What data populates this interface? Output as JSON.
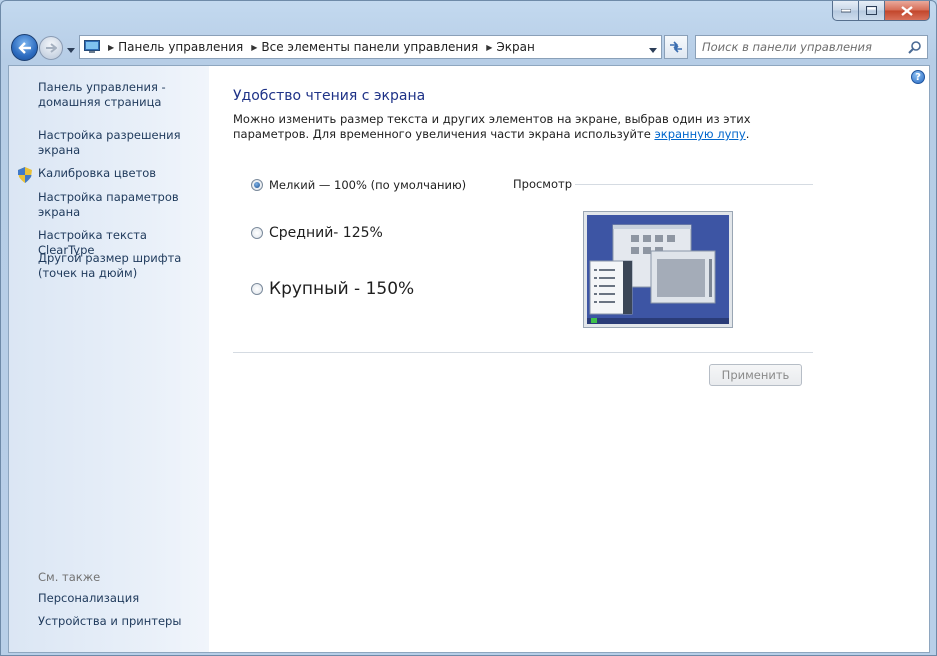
{
  "window": {
    "minimize_icon": "minimize-icon",
    "maximize_icon": "maximize-icon",
    "close_icon": "close-icon"
  },
  "address_bar": {
    "breadcrumbs": [
      "Панель управления",
      "Все элементы панели управления",
      "Экран"
    ]
  },
  "search": {
    "placeholder": "Поиск в панели управления"
  },
  "sidebar": {
    "items": [
      {
        "label": "Панель управления - домашняя страница"
      },
      {
        "label": "Настройка разрешения экрана"
      },
      {
        "label": "Калибровка цветов",
        "icon": "shield-icon"
      },
      {
        "label": "Настройка параметров экрана"
      },
      {
        "label": "Настройка текста ClearType"
      },
      {
        "label": "Другой размер шрифта (точек на дюйм)"
      }
    ],
    "see_also_title": "См. также",
    "see_also": [
      {
        "label": "Персонализация"
      },
      {
        "label": "Устройства и принтеры"
      }
    ]
  },
  "main": {
    "title": "Удобство чтения с экрана",
    "description_before": "Можно изменить размер текста и других элементов на экране, выбрав один из этих параметров. Для временного увеличения части экрана используйте ",
    "description_link": "экранную лупу",
    "description_after": ".",
    "options": [
      {
        "label": "Мелкий — 100% (по умолчанию)",
        "selected": true
      },
      {
        "label": "Средний- 125%",
        "selected": false
      },
      {
        "label": "Крупный - 150%",
        "selected": false
      }
    ],
    "preview_label": "Просмотр",
    "apply_label": "Применить"
  }
}
